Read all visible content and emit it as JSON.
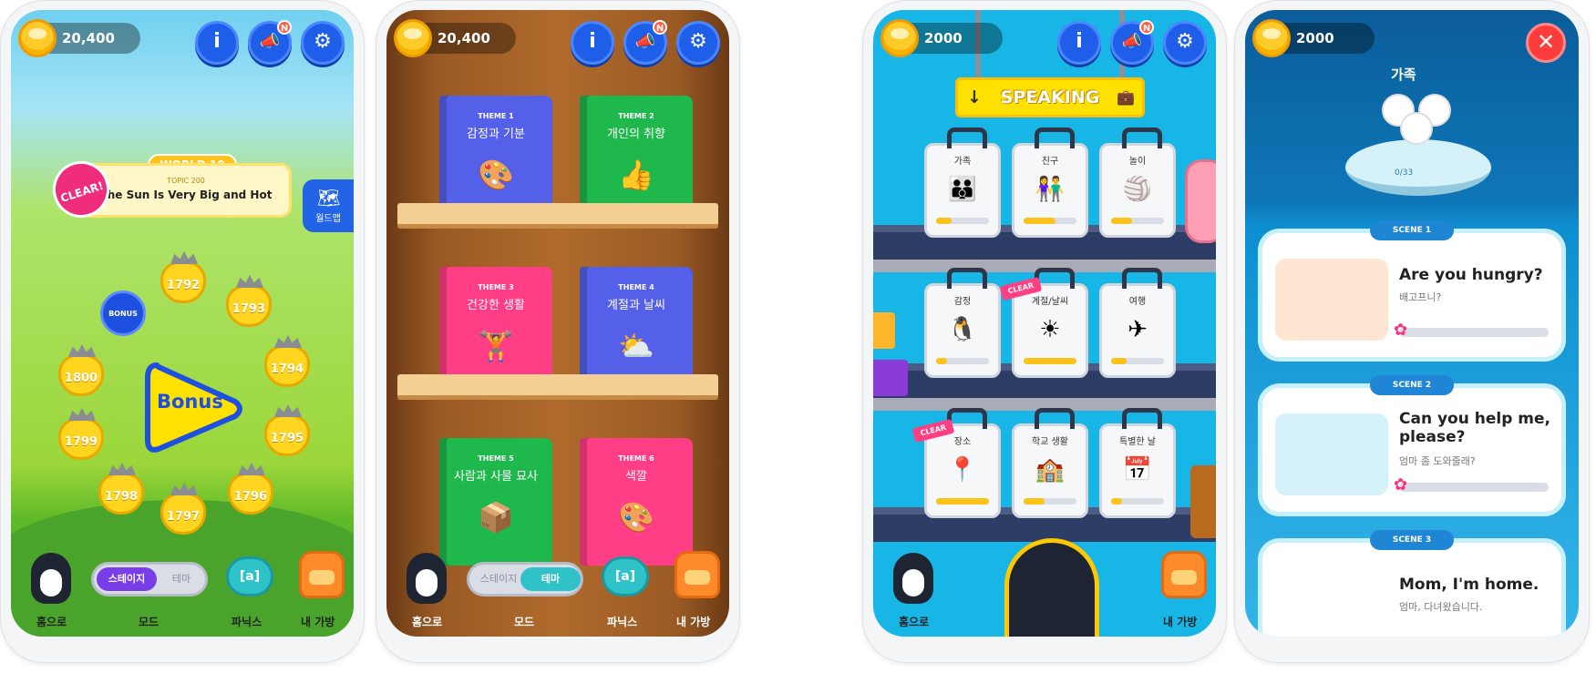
{
  "screen1": {
    "coins": "20,400",
    "world_label": "WORLD 10",
    "topic_label": "TOPIC 200",
    "topic_title": "The Sun Is Very Big and Hot",
    "clear_badge": "CLEAR!",
    "worldmap_label": "월드맵",
    "bonus_small": "BONUS",
    "bonus_big": "Bonus",
    "nodes": [
      "1792",
      "1793",
      "1794",
      "1795",
      "1796",
      "1797",
      "1798",
      "1799",
      "1800"
    ],
    "mode_toggle": {
      "on": "스테이지",
      "off": "테마"
    },
    "nav": {
      "home": "홈으로",
      "mode": "모드",
      "phonics": "파닉스",
      "bag": "내 가방"
    }
  },
  "screen2": {
    "coins": "20,400",
    "books": [
      {
        "theme": "THEME 1",
        "title": "감정과 기분",
        "icon": "🎨",
        "color": "#5560e8"
      },
      {
        "theme": "THEME 2",
        "title": "개인의 취향",
        "icon": "👍",
        "color": "#1fb84d"
      },
      {
        "theme": "THEME 3",
        "title": "건강한 생활",
        "icon": "🏋",
        "color": "#ff3e86"
      },
      {
        "theme": "THEME 4",
        "title": "계절과 날씨",
        "icon": "⛅",
        "color": "#5560e8"
      },
      {
        "theme": "THEME 5",
        "title": "사람과 사물 묘사",
        "icon": "📦",
        "color": "#1fb84d"
      },
      {
        "theme": "THEME 6",
        "title": "색깔",
        "icon": "🎨",
        "color": "#ff3e86"
      }
    ],
    "mode_toggle": {
      "on": "테마",
      "off": "스테이지"
    },
    "nav": {
      "home": "홈으로",
      "mode": "모드",
      "phonics": "파닉스",
      "bag": "내 가방"
    }
  },
  "screen3": {
    "coins": "2000",
    "speaking_label": "SPEAKING",
    "suitcases": [
      {
        "label": "가족",
        "icon": "👪",
        "progress": 0.3
      },
      {
        "label": "친구",
        "icon": "👫",
        "progress": 0.6
      },
      {
        "label": "놀이",
        "icon": "🏐",
        "progress": 0.4
      },
      {
        "label": "감정",
        "icon": "🐧",
        "progress": 0.2
      },
      {
        "label": "계절/날씨",
        "icon": "☀",
        "progress": 1.0,
        "clear": true
      },
      {
        "label": "여행",
        "icon": "✈",
        "progress": 0.3
      },
      {
        "label": "장소",
        "icon": "📍",
        "progress": 1.0,
        "clear": true
      },
      {
        "label": "학교 생활",
        "icon": "🏫",
        "progress": 0.4
      },
      {
        "label": "특별한 날",
        "icon": "📅",
        "progress": 0.2
      }
    ],
    "clear_tag": "CLEAR",
    "nav": {
      "home": "홈으로",
      "bag": "내 가방"
    }
  },
  "screen4": {
    "coins": "2000",
    "category": "가족",
    "stage_progress": "0/33",
    "close": "✕",
    "scenes": [
      {
        "pill": "SCENE 1",
        "en": "Are you hungry?",
        "ko": "배고프니?"
      },
      {
        "pill": "SCENE 2",
        "en": "Can you help me, please?",
        "ko": "엄마 좀 도와줄래?"
      },
      {
        "pill": "SCENE 3",
        "en": "Mom, I'm home.",
        "ko": "엄마, 다녀왔습니다."
      }
    ]
  },
  "icons": {
    "info": "i",
    "megaphone": "📣",
    "settings": "⚙",
    "new_badge": "N"
  }
}
